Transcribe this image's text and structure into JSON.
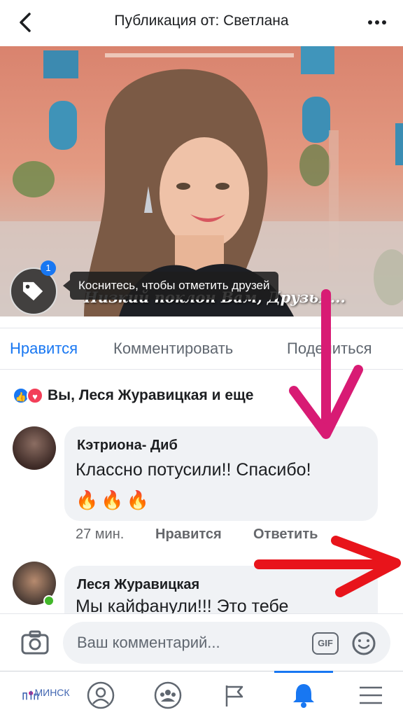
{
  "header": {
    "title": "Публикация от: Светлана"
  },
  "photo": {
    "tag_count": "1",
    "tag_hint": "Коснитесь, чтобы отметить друзей",
    "caption": "Низкий поклон Вам, Друзья..."
  },
  "actions": {
    "like": "Нравится",
    "comment": "Комментировать",
    "share": "Поделиться"
  },
  "reactions": {
    "summary": "Вы, Леся Журавицкая и еще"
  },
  "comments": [
    {
      "author": "Кэтриона- Диб",
      "text": "Классно потусили!! Спасибо!",
      "emoji": "🔥🔥🔥",
      "time": "27 мин.",
      "like": "Нравится",
      "reply": "Ответить"
    },
    {
      "author": "Леся Журавицкая",
      "text": "Мы кайфанули!!! Это тебе"
    }
  ],
  "composer": {
    "placeholder": "Ваш комментарий...",
    "gif_label": "GIF"
  },
  "tabbar": {
    "city_label": "МИНСК",
    "active_tab": "notifications"
  },
  "colors": {
    "accent": "#1877f2",
    "annotation_magenta": "#d81b74",
    "annotation_red": "#e8141b"
  }
}
